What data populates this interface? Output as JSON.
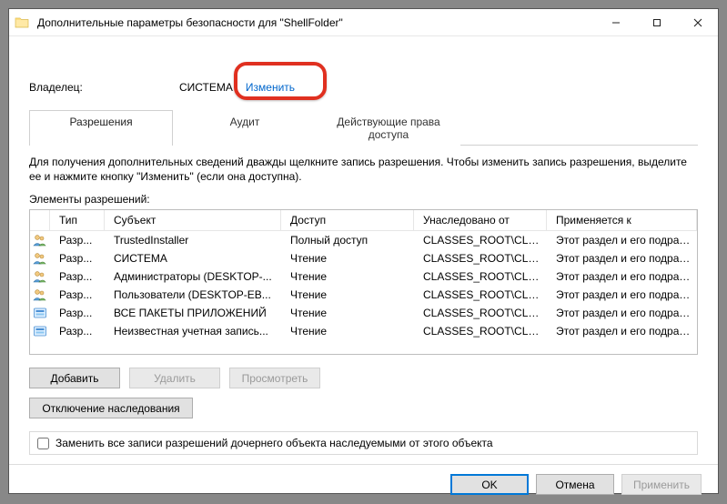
{
  "window": {
    "title": "Дополнительные параметры безопасности  для \"ShellFolder\""
  },
  "owner": {
    "label": "Владелец:",
    "value": "СИСТЕМА",
    "change_link": "Изменить"
  },
  "tabs": [
    {
      "label": "Разрешения",
      "active": true
    },
    {
      "label": "Аудит",
      "active": false
    },
    {
      "label": "Действующие права доступа",
      "active": false
    }
  ],
  "instruction": "Для получения дополнительных сведений дважды щелкните запись разрешения. Чтобы изменить запись разрешения, выделите ее и нажмите кнопку \"Изменить\" (если она доступна).",
  "list_label": "Элементы разрешений:",
  "columns": {
    "type": "Тип",
    "subject": "Субъект",
    "access": "Доступ",
    "inherited": "Унаследовано от",
    "applies": "Применяется к"
  },
  "rows": [
    {
      "icon": "group",
      "type": "Разр...",
      "subject": "TrustedInstaller",
      "access": "Полный доступ",
      "inherited": "CLASSES_ROOT\\CLSID\\...",
      "applies": "Этот раздел и его подразделы"
    },
    {
      "icon": "group",
      "type": "Разр...",
      "subject": "СИСТЕМА",
      "access": "Чтение",
      "inherited": "CLASSES_ROOT\\CLSID\\...",
      "applies": "Этот раздел и его подразделы"
    },
    {
      "icon": "group",
      "type": "Разр...",
      "subject": "Администраторы (DESKTOP-...",
      "access": "Чтение",
      "inherited": "CLASSES_ROOT\\CLSID\\...",
      "applies": "Этот раздел и его подразделы"
    },
    {
      "icon": "group",
      "type": "Разр...",
      "subject": "Пользователи (DESKTOP-EB...",
      "access": "Чтение",
      "inherited": "CLASSES_ROOT\\CLSID\\...",
      "applies": "Этот раздел и его подразделы"
    },
    {
      "icon": "package",
      "type": "Разр...",
      "subject": "ВСЕ ПАКЕТЫ ПРИЛОЖЕНИЙ",
      "access": "Чтение",
      "inherited": "CLASSES_ROOT\\CLSID\\...",
      "applies": "Этот раздел и его подразделы"
    },
    {
      "icon": "package",
      "type": "Разр...",
      "subject": "Неизвестная учетная запись...",
      "access": "Чтение",
      "inherited": "CLASSES_ROOT\\CLSID\\...",
      "applies": "Этот раздел и его подразделы"
    }
  ],
  "buttons": {
    "add": "Добавить",
    "remove": "Удалить",
    "view": "Просмотреть",
    "disable_inherit": "Отключение наследования"
  },
  "checkbox": {
    "label": "Заменить все записи разрешений дочернего объекта наследуемыми от этого объекта"
  },
  "footer": {
    "ok": "OK",
    "cancel": "Отмена",
    "apply": "Применить"
  }
}
